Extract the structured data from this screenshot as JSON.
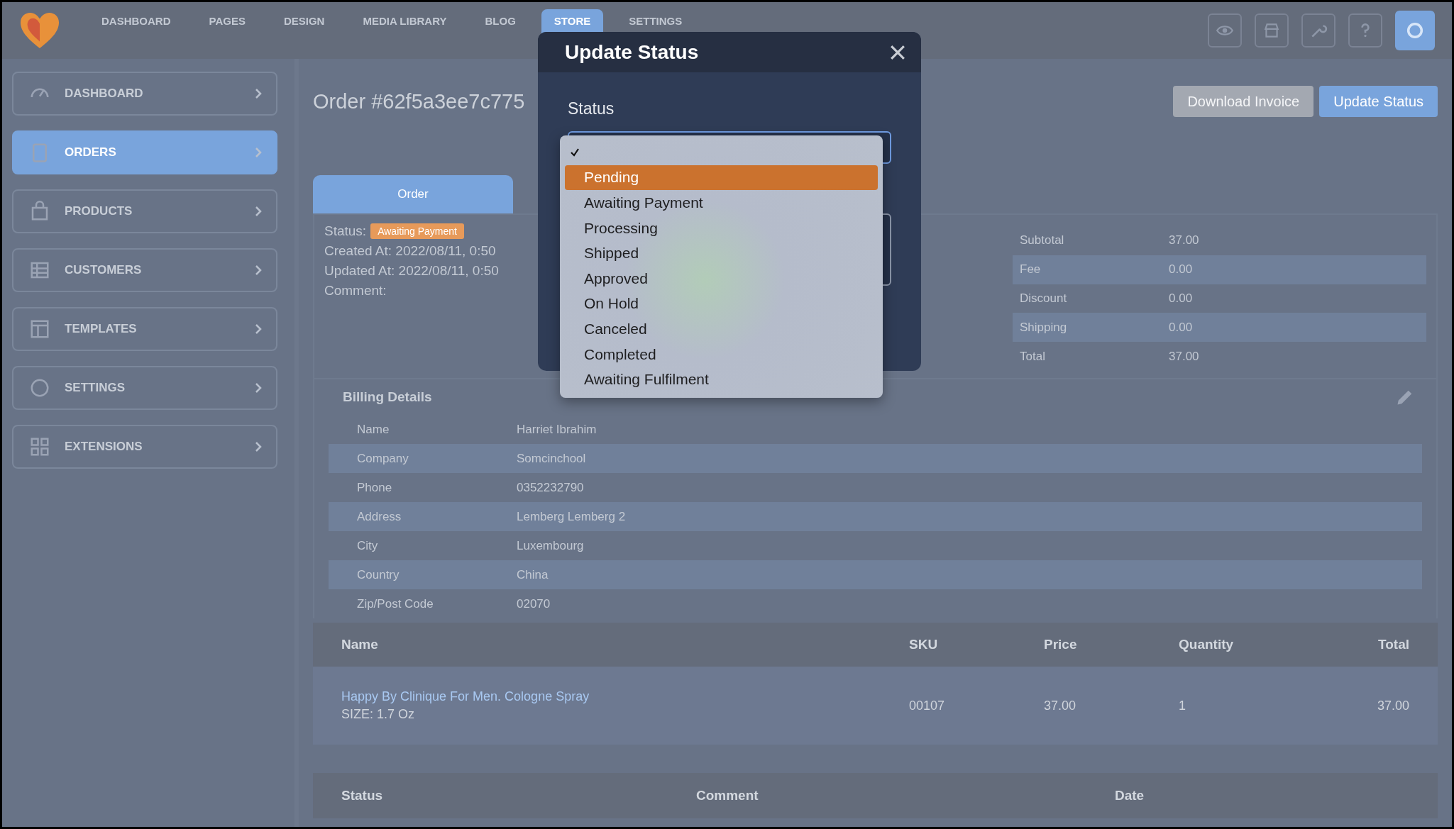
{
  "top_nav": {
    "items": [
      {
        "label": "DASHBOARD",
        "selected": false
      },
      {
        "label": "PAGES",
        "selected": false
      },
      {
        "label": "DESIGN",
        "selected": false
      },
      {
        "label": "MEDIA LIBRARY",
        "selected": false
      },
      {
        "label": "BLOG",
        "selected": false
      },
      {
        "label": "STORE",
        "selected": true
      },
      {
        "label": "SETTINGS",
        "selected": false
      }
    ]
  },
  "sidebar": {
    "items": [
      {
        "label": "DASHBOARD",
        "selected": false
      },
      {
        "label": "ORDERS",
        "selected": true
      },
      {
        "label": "PRODUCTS",
        "selected": false
      },
      {
        "label": "CUSTOMERS",
        "selected": false
      },
      {
        "label": "TEMPLATES",
        "selected": false
      },
      {
        "label": "SETTINGS",
        "selected": false
      },
      {
        "label": "EXTENSIONS",
        "selected": false
      }
    ]
  },
  "page": {
    "title": "Order #62f5a3ee7c775",
    "buttons": [
      {
        "label": "Download Invoice",
        "kind": "secondary"
      },
      {
        "label": "Update Status",
        "kind": "primary"
      }
    ]
  },
  "tabs": [
    {
      "label": "Order",
      "selected": true
    }
  ],
  "order_info": {
    "status_label": "Status:",
    "status": "Awaiting Payment",
    "lines": [
      "Created At: 2022/08/11, 0:50",
      "Updated At: 2022/08/11, 0:50",
      "Comment:"
    ]
  },
  "summary": [
    {
      "label": "Subtotal",
      "value": "37.00"
    },
    {
      "label": "Fee",
      "value": "0.00"
    },
    {
      "label": "Discount",
      "value": "0.00"
    },
    {
      "label": "Shipping",
      "value": "0.00"
    },
    {
      "label": "Total",
      "value": "37.00"
    }
  ],
  "billing": {
    "title": "Billing Details",
    "rows": [
      {
        "label": "Name",
        "value": "Harriet Ibrahim"
      },
      {
        "label": "Company",
        "value": "Somcinchool"
      },
      {
        "label": "Phone",
        "value": "0352232790"
      },
      {
        "label": "Address",
        "value": "Lemberg Lemberg 2"
      },
      {
        "label": "City",
        "value": "Luxembourg"
      },
      {
        "label": "Country",
        "value": "China"
      },
      {
        "label": "Zip/Post Code",
        "value": "02070"
      }
    ]
  },
  "items_table": {
    "columns": [
      "Name",
      "SKU",
      "Price",
      "Quantity",
      "Total"
    ],
    "rows": [
      {
        "name": "Happy By Clinique For Men. Cologne Spray",
        "option": "SIZE: 1.7 Oz",
        "sku": "00107",
        "price": "37.00",
        "quantity": "1",
        "total": "37.00"
      }
    ]
  },
  "history_table": {
    "columns": [
      "Status",
      "Comment",
      "Date"
    ]
  },
  "modal": {
    "title": "Update Status",
    "field_label": "Status",
    "options": [
      {
        "selected": true,
        "hovered": false
      },
      {
        "label": "Pending",
        "selected": false,
        "hovered": true
      },
      {
        "label": "Awaiting Payment",
        "selected": false,
        "hovered": false
      },
      {
        "label": "Processing",
        "selected": false,
        "hovered": false
      },
      {
        "label": "Shipped",
        "selected": false,
        "hovered": false
      },
      {
        "label": "Approved",
        "selected": false,
        "hovered": false
      },
      {
        "label": "On Hold",
        "selected": false,
        "hovered": false
      },
      {
        "label": "Canceled",
        "selected": false,
        "hovered": false
      },
      {
        "label": "Completed",
        "selected": false,
        "hovered": false
      },
      {
        "label": "Awaiting Fulfilment",
        "selected": false,
        "hovered": false
      }
    ]
  }
}
